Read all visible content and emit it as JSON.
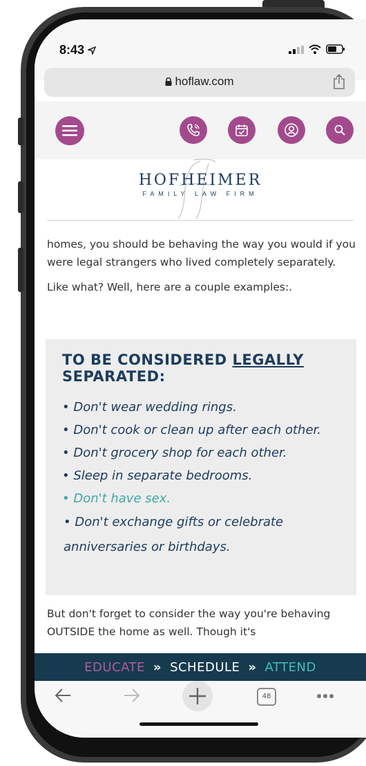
{
  "status": {
    "time": "8:43"
  },
  "browser": {
    "url": "hoflaw.com",
    "tab_count": "48"
  },
  "logo": {
    "name": "HOFHEIMER",
    "tagline": "FAMILY LAW FIRM"
  },
  "article": {
    "paragraph1": "homes, you should be behaving the way you would if you were legal strangers who lived completely separately.",
    "paragraph2": "Like what?  Well, here are a couple examples:.",
    "callout": {
      "heading_part1": "TO BE CONSIDERED ",
      "heading_underlined": "LEGALLY",
      "heading_part2": "SEPARATED:",
      "items": [
        "• Don't wear wedding rings.",
        "• Don't cook or clean up after each other.",
        "• Don't grocery shop for each other.",
        "• Sleep in separate bedrooms.",
        "• Don't have sex.",
        "• Don't exchange gifts or celebrate anniversaries or birthdays."
      ]
    },
    "paragraph3": "But don't forget to consider the way you're behaving OUTSIDE the home as well.  Though it's"
  },
  "cta": {
    "educate": "EDUCATE",
    "separator": "»",
    "schedule": "SCHEDULE",
    "attend": "ATTEND"
  },
  "colors": {
    "brand_purple": "#a34a8c",
    "brand_navy": "#1d3c5e",
    "link_teal": "#3fa9a6",
    "cta_bg": "#163a4e"
  },
  "icons": {
    "menu": "hamburger-menu-icon",
    "phone": "phone-icon",
    "calendar": "calendar-icon",
    "account": "user-icon",
    "search": "search-icon",
    "back": "back-arrow-icon",
    "forward": "forward-arrow-icon",
    "new_tab": "plus-icon",
    "more": "more-icon",
    "share": "share-icon",
    "lock": "lock-icon"
  }
}
